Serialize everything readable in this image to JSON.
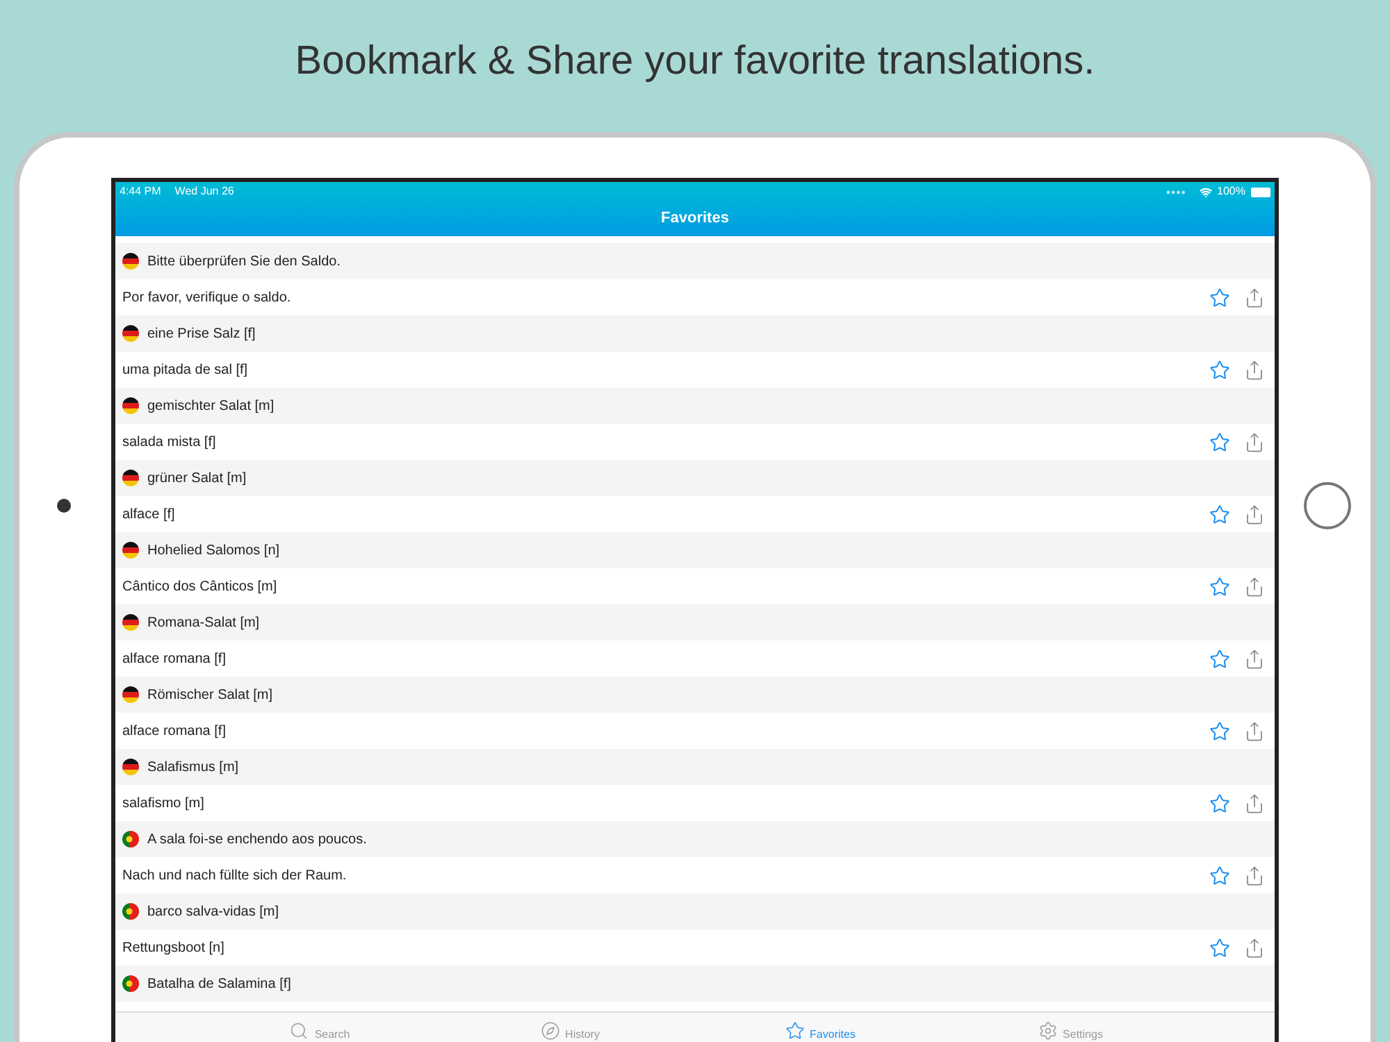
{
  "headline": "Bookmark & Share your favorite translations.",
  "status_bar": {
    "time": "4:44 PM",
    "date": "Wed Jun 26",
    "battery": "100%"
  },
  "nav_title": "Favorites",
  "entries": [
    {
      "kind": "de",
      "source": "Bitte überprüfen Sie den Saldo.",
      "target": "Por favor, verifique o saldo."
    },
    {
      "kind": "de",
      "source": "eine Prise Salz [f]",
      "target": "uma pitada de sal [f]"
    },
    {
      "kind": "de",
      "source": "gemischter Salat [m]",
      "target": "salada mista [f]"
    },
    {
      "kind": "de",
      "source": "grüner Salat [m]",
      "target": "alface [f]"
    },
    {
      "kind": "de",
      "source": "Hohelied Salomos [n]",
      "target": "Cântico dos Cânticos [m]"
    },
    {
      "kind": "de",
      "source": "Romana-Salat [m]",
      "target": "alface romana [f]"
    },
    {
      "kind": "de",
      "source": "Römischer Salat [m]",
      "target": "alface romana [f]"
    },
    {
      "kind": "de",
      "source": "Salafismus [m]",
      "target": "salafismo [m]"
    },
    {
      "kind": "pt",
      "source": "A sala foi-se enchendo aos poucos.",
      "target": "Nach und nach füllte sich der Raum."
    },
    {
      "kind": "pt",
      "source": "barco salva-vidas [m]",
      "target": "Rettungsboot [n]"
    },
    {
      "kind": "pt",
      "source": "Batalha de Salamina [f]"
    }
  ],
  "tabs": [
    {
      "kind": "search",
      "label": "Search",
      "selected": false
    },
    {
      "kind": "history",
      "label": "History",
      "selected": false
    },
    {
      "kind": "favorites",
      "label": "Favorites",
      "selected": true
    },
    {
      "kind": "settings",
      "label": "Settings",
      "selected": false
    }
  ]
}
